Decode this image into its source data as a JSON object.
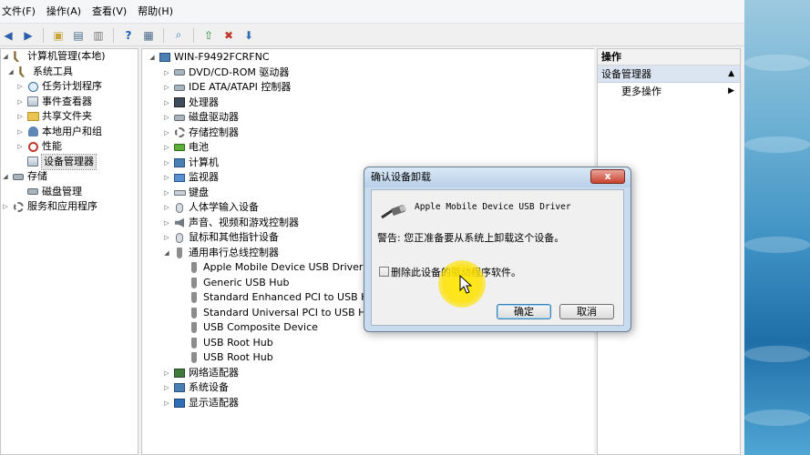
{
  "menubar": {
    "items": [
      "文件(F)",
      "操作(A)",
      "查看(V)",
      "帮助(H)"
    ]
  },
  "toolbar": {
    "icons": [
      "back-icon",
      "forward-icon",
      "up-folder-icon",
      "show-hide-tree-icon",
      "export-icon",
      "help-icon",
      "properties-icon",
      "scan-hardware-icon",
      "update-driver-icon",
      "disable-device-icon",
      "uninstall-device-icon"
    ]
  },
  "left_tree": {
    "root": "计算机管理(本地)",
    "items": [
      {
        "label": "系统工具",
        "level": 1
      },
      {
        "label": "任务计划程序",
        "level": 2
      },
      {
        "label": "事件查看器",
        "level": 2
      },
      {
        "label": "共享文件夹",
        "level": 2
      },
      {
        "label": "本地用户和组",
        "level": 2
      },
      {
        "label": "性能",
        "level": 2
      },
      {
        "label": "设备管理器",
        "level": 2
      },
      {
        "label": "存储",
        "level": 1
      },
      {
        "label": "磁盘管理",
        "level": 2
      },
      {
        "label": "服务和应用程序",
        "level": 1
      }
    ]
  },
  "device_tree": {
    "computer": "WIN-F9492FCRFNC",
    "categories": [
      "DVD/CD-ROM 驱动器",
      "IDE ATA/ATAPI 控制器",
      "处理器",
      "磁盘驱动器",
      "存储控制器",
      "电池",
      "计算机",
      "监视器",
      "键盘",
      "人体学输入设备",
      "声音、视频和游戏控制器",
      "鼠标和其他指针设备",
      "通用串行总线控制器"
    ],
    "usb_devices": [
      "Apple Mobile Device USB Driver",
      "Generic USB Hub",
      "Standard Enhanced PCI to USB Host",
      "Standard Universal PCI to USB Host",
      "USB Composite Device",
      "USB Root Hub",
      "USB Root Hub"
    ],
    "categories_after": [
      "网络适配器",
      "系统设备",
      "显示适配器"
    ]
  },
  "actions": {
    "header": "操作",
    "section": "设备管理器",
    "more": "更多操作"
  },
  "dialog": {
    "title": "确认设备卸载",
    "close_label": "x",
    "device_name": "Apple Mobile Device USB Driver",
    "warning": "警告: 您正准备要从系统上卸载这个设备。",
    "checkbox_label": "删除此设备的驱动程序软件。",
    "checkbox_checked": false,
    "ok_label": "确定",
    "cancel_label": "取消"
  }
}
